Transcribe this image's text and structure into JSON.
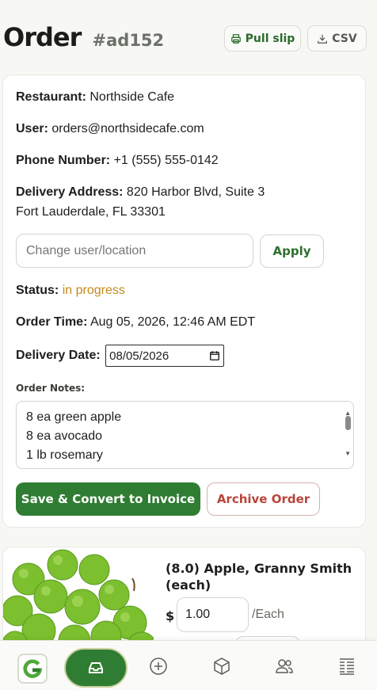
{
  "header": {
    "title": "Order",
    "order_id": "#ad152",
    "pull_slip_label": "Pull slip",
    "csv_label": "CSV"
  },
  "order": {
    "restaurant_label": "Restaurant:",
    "restaurant": "Northside Cafe",
    "user_label": "User:",
    "user": "orders@northsidecafe.com",
    "phone_label": "Phone Number:",
    "phone": "+1 (555) 555-0142",
    "address_label": "Delivery Address:",
    "address_line1": "820 Harbor Blvd, Suite 3",
    "address_line2": "Fort Lauderdale, FL 33301",
    "change_placeholder": "Change user/location",
    "apply_label": "Apply",
    "status_label": "Status:",
    "status": "in progress",
    "status_color": "#c58a1a",
    "order_time_label": "Order Time:",
    "order_time": "Aug 05, 2026, 12:46 AM EDT",
    "delivery_date_label": "Delivery Date:",
    "delivery_date": "08/05/2026",
    "notes_label": "Order Notes:",
    "notes_lines": [
      "8 ea green apple",
      "8 ea  avocado",
      "1 lb rosemary"
    ],
    "save_label": "Save & Convert to Invoice",
    "archive_label": "Archive Order"
  },
  "item": {
    "title": "(8.0) Apple, Granny Smith (each)",
    "currency": "$",
    "price": "1.00",
    "unit": "/Each"
  },
  "nav": {
    "items": [
      "logo",
      "orders-icon",
      "add-icon",
      "box-icon",
      "users-icon",
      "list-icon"
    ],
    "active": "orders-icon",
    "accent": "#2f7d32"
  }
}
